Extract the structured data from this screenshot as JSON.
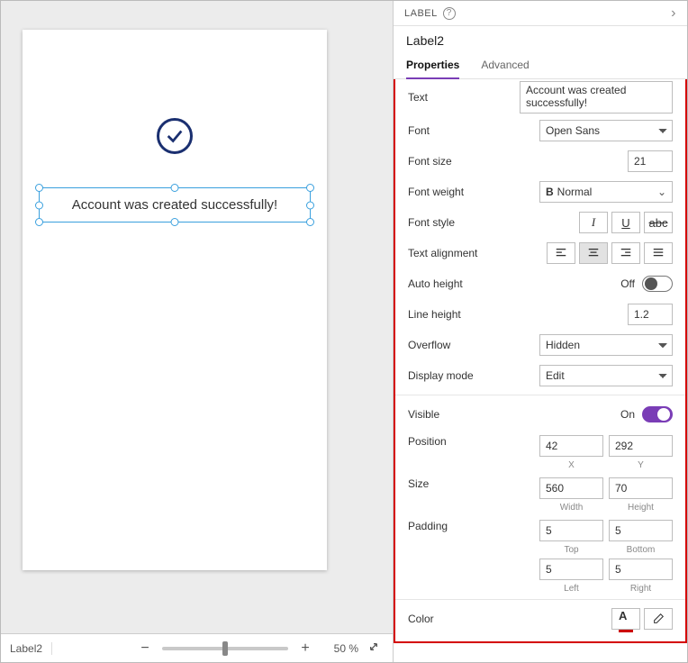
{
  "canvas": {
    "success_text": "Account was created successfully!"
  },
  "footer": {
    "selection": "Label2",
    "zoom": "50  %"
  },
  "panel": {
    "header": "LABEL",
    "title": "Label2",
    "tabs": {
      "properties": "Properties",
      "advanced": "Advanced"
    },
    "props": {
      "text_label": "Text",
      "text_value": "Account was created successfully!",
      "font_label": "Font",
      "font_value": "Open Sans",
      "fontsize_label": "Font size",
      "fontsize_value": "21",
      "fontweight_label": "Font weight",
      "fontweight_value": "Normal",
      "fontstyle_label": "Font style",
      "align_label": "Text alignment",
      "autoheight_label": "Auto height",
      "autoheight_value": "Off",
      "lineheight_label": "Line height",
      "lineheight_value": "1.2",
      "overflow_label": "Overflow",
      "overflow_value": "Hidden",
      "displaymode_label": "Display mode",
      "displaymode_value": "Edit",
      "visible_label": "Visible",
      "visible_value": "On",
      "position_label": "Position",
      "pos_x": "42",
      "pos_y": "292",
      "pos_x_cap": "X",
      "pos_y_cap": "Y",
      "size_label": "Size",
      "size_w": "560",
      "size_h": "70",
      "size_w_cap": "Width",
      "size_h_cap": "Height",
      "padding_label": "Padding",
      "pad_t": "5",
      "pad_b": "5",
      "pad_l": "5",
      "pad_r": "5",
      "pad_t_cap": "Top",
      "pad_b_cap": "Bottom",
      "pad_l_cap": "Left",
      "pad_r_cap": "Right",
      "color_label": "Color"
    }
  }
}
